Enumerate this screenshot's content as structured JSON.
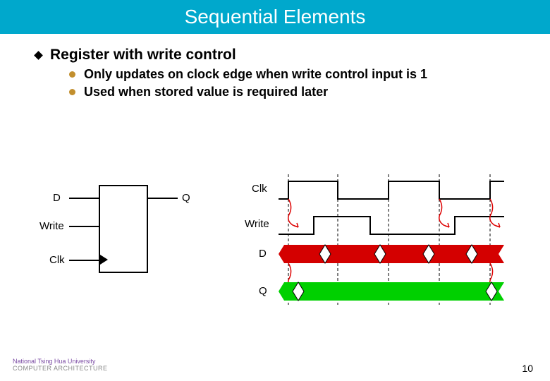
{
  "title": "Sequential Elements",
  "bullets": {
    "l1": "Register with write control",
    "l2a": "Only updates on clock edge when write control input is 1",
    "l2b": "Used when stored value is required later"
  },
  "block": {
    "D": "D",
    "Q": "Q",
    "Write": "Write",
    "Clk": "Clk"
  },
  "timing": {
    "Clk": "Clk",
    "Write": "Write",
    "D": "D",
    "Q": "Q"
  },
  "footer": {
    "uni": "National Tsing Hua University",
    "arch": "COMPUTER ARCHITECTURE"
  },
  "page": "10"
}
